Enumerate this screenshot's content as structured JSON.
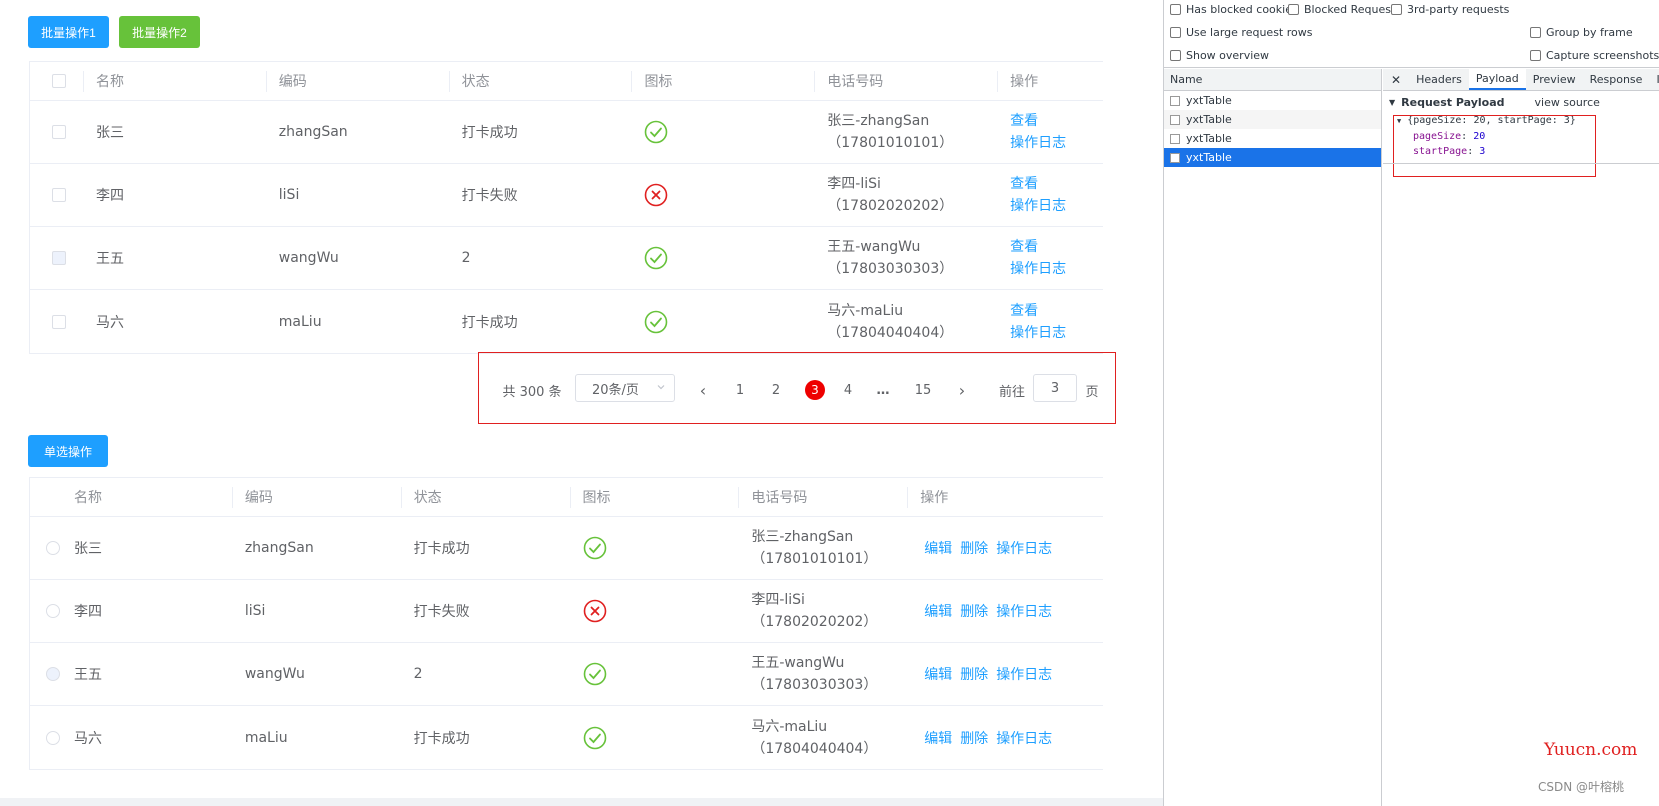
{
  "buttons": {
    "batch1": "批量操作1",
    "batch2": "批量操作2",
    "single": "单选操作"
  },
  "table1": {
    "headers": [
      "名称",
      "编码",
      "状态",
      "图标",
      "电话号码",
      "操作"
    ],
    "rows": [
      {
        "name": "张三",
        "code": "zhangSan",
        "status": "打卡成功",
        "icon": "check-circle-icon",
        "tel1": "张三-zhangSan",
        "tel2": "（17801010101）",
        "op1": "查看",
        "op2": "操作日志"
      },
      {
        "name": "李四",
        "code": "liSi",
        "status": "打卡失败",
        "icon": "cross-circle-icon",
        "tel1": "李四-liSi",
        "tel2": "（17802020202）",
        "op1": "查看",
        "op2": "操作日志"
      },
      {
        "name": "王五",
        "code": "wangWu",
        "status": "2",
        "icon": "check-circle-icon",
        "tel1": "王五-wangWu",
        "tel2": "（17803030303）",
        "op1": "查看",
        "op2": "操作日志"
      },
      {
        "name": "马六",
        "code": "maLiu",
        "status": "打卡成功",
        "icon": "check-circle-icon",
        "tel1": "马六-maLiu",
        "tel2": "（17804040404）",
        "op1": "查看",
        "op2": "操作日志"
      }
    ]
  },
  "pagination": {
    "total": "共 300 条",
    "page_size": "20条/页",
    "prev": "‹",
    "pages": [
      "1",
      "2",
      "3",
      "4",
      "…",
      "15"
    ],
    "current": "3",
    "next": "›",
    "goto_label": "前往",
    "goto_value": "3",
    "goto_unit": "页"
  },
  "table2": {
    "headers": [
      "名称",
      "编码",
      "状态",
      "图标",
      "电话号码",
      "操作"
    ],
    "rows": [
      {
        "name": "张三",
        "code": "zhangSan",
        "status": "打卡成功",
        "icon": "check-circle-icon",
        "tel1": "张三-zhangSan",
        "tel2": "（17801010101）",
        "edit": "编辑",
        "del": "删除",
        "log": "操作日志"
      },
      {
        "name": "李四",
        "code": "liSi",
        "status": "打卡失败",
        "icon": "cross-circle-icon",
        "tel1": "李四-liSi",
        "tel2": "（17802020202）",
        "edit": "编辑",
        "del": "删除",
        "log": "操作日志"
      },
      {
        "name": "王五",
        "code": "wangWu",
        "status": "2",
        "icon": "check-circle-icon",
        "tel1": "王五-wangWu",
        "tel2": "（17803030303）",
        "edit": "编辑",
        "del": "删除",
        "log": "操作日志"
      },
      {
        "name": "马六",
        "code": "maLiu",
        "status": "打卡成功",
        "icon": "check-circle-icon",
        "tel1": "马六-maLiu",
        "tel2": "（17804040404）",
        "edit": "编辑",
        "del": "删除",
        "log": "操作日志"
      }
    ]
  },
  "devtools": {
    "options": {
      "blocked_cookies": "Has blocked cookies",
      "blocked_requests": "Blocked Requests",
      "third_party": "3rd-party requests",
      "large_rows": "Use large request rows",
      "group_by_frame": "Group by frame",
      "show_overview": "Show overview",
      "capture_screenshots": "Capture screenshots"
    },
    "name_header": "Name",
    "requests": [
      "yxtTable",
      "yxtTable",
      "yxtTable",
      "yxtTable"
    ],
    "tabs": [
      "Headers",
      "Payload",
      "Preview",
      "Response",
      "Initia"
    ],
    "active_tab": "Payload",
    "payload_title": "Request Payload",
    "view_source": "view source",
    "summary": "{pageSize: 20, startPage: 3}",
    "fields": [
      {
        "key": "pageSize",
        "value": "20"
      },
      {
        "key": "startPage",
        "value": "3"
      }
    ]
  },
  "watermark": {
    "site": "Yuucn.com",
    "author": "CSDN @叶榕桃"
  },
  "colors": {
    "primary": "#1e9fff",
    "success": "#67c23a",
    "danger": "#e02020",
    "devtools_selected": "#1a73e8"
  }
}
